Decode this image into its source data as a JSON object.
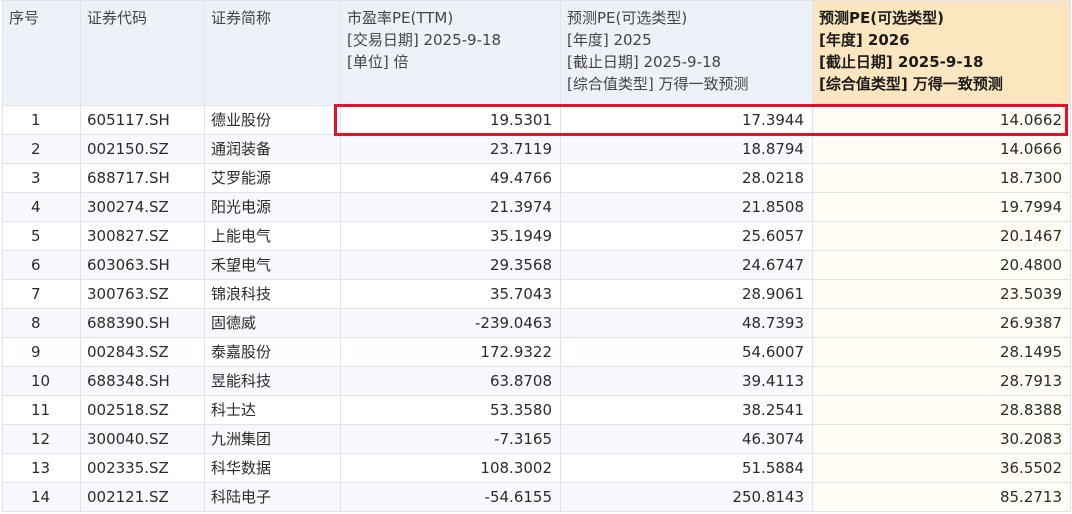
{
  "columns": {
    "seq": "序号",
    "code": "证券代码",
    "name": "证券简称",
    "pe_ttm": [
      "市盈率PE(TTM)",
      "[交易日期] 2025-9-18",
      "[单位] 倍"
    ],
    "pe_2025": [
      "预测PE(可选类型)",
      "[年度] 2025",
      "[截止日期] 2025-9-18",
      "[综合值类型] 万得一致预测"
    ],
    "pe_2026": [
      "预测PE(可选类型)",
      "[年度] 2026",
      "[截止日期] 2025-9-18",
      "[综合值类型] 万得一致预测"
    ]
  },
  "highlight_color": "#e3122a",
  "rows": [
    {
      "seq": "1",
      "code": "605117.SH",
      "name": "德业股份",
      "pe_ttm": "19.5301",
      "pe_2025": "17.3944",
      "pe_2026": "14.0662"
    },
    {
      "seq": "2",
      "code": "002150.SZ",
      "name": "通润装备",
      "pe_ttm": "23.7119",
      "pe_2025": "18.8794",
      "pe_2026": "14.0666"
    },
    {
      "seq": "3",
      "code": "688717.SH",
      "name": "艾罗能源",
      "pe_ttm": "49.4766",
      "pe_2025": "28.0218",
      "pe_2026": "18.7300"
    },
    {
      "seq": "4",
      "code": "300274.SZ",
      "name": "阳光电源",
      "pe_ttm": "21.3974",
      "pe_2025": "21.8508",
      "pe_2026": "19.7994"
    },
    {
      "seq": "5",
      "code": "300827.SZ",
      "name": "上能电气",
      "pe_ttm": "35.1949",
      "pe_2025": "25.6057",
      "pe_2026": "20.1467"
    },
    {
      "seq": "6",
      "code": "603063.SH",
      "name": "禾望电气",
      "pe_ttm": "29.3568",
      "pe_2025": "24.6747",
      "pe_2026": "20.4800"
    },
    {
      "seq": "7",
      "code": "300763.SZ",
      "name": "锦浪科技",
      "pe_ttm": "35.7043",
      "pe_2025": "28.9061",
      "pe_2026": "23.5039"
    },
    {
      "seq": "8",
      "code": "688390.SH",
      "name": "固德威",
      "pe_ttm": "-239.0463",
      "pe_2025": "48.7393",
      "pe_2026": "26.9387"
    },
    {
      "seq": "9",
      "code": "002843.SZ",
      "name": "泰嘉股份",
      "pe_ttm": "172.9322",
      "pe_2025": "54.6007",
      "pe_2026": "28.1495"
    },
    {
      "seq": "10",
      "code": "688348.SH",
      "name": "昱能科技",
      "pe_ttm": "63.8708",
      "pe_2025": "39.4113",
      "pe_2026": "28.7913"
    },
    {
      "seq": "11",
      "code": "002518.SZ",
      "name": "科士达",
      "pe_ttm": "53.3580",
      "pe_2025": "38.2541",
      "pe_2026": "28.8388"
    },
    {
      "seq": "12",
      "code": "300040.SZ",
      "name": "九洲集团",
      "pe_ttm": "-7.3165",
      "pe_2025": "46.3074",
      "pe_2026": "30.2083"
    },
    {
      "seq": "13",
      "code": "002335.SZ",
      "name": "科华数据",
      "pe_ttm": "108.3002",
      "pe_2025": "51.5884",
      "pe_2026": "36.5502"
    },
    {
      "seq": "14",
      "code": "002121.SZ",
      "name": "科陆电子",
      "pe_ttm": "-54.6155",
      "pe_2025": "250.8143",
      "pe_2026": "85.2713"
    }
  ]
}
